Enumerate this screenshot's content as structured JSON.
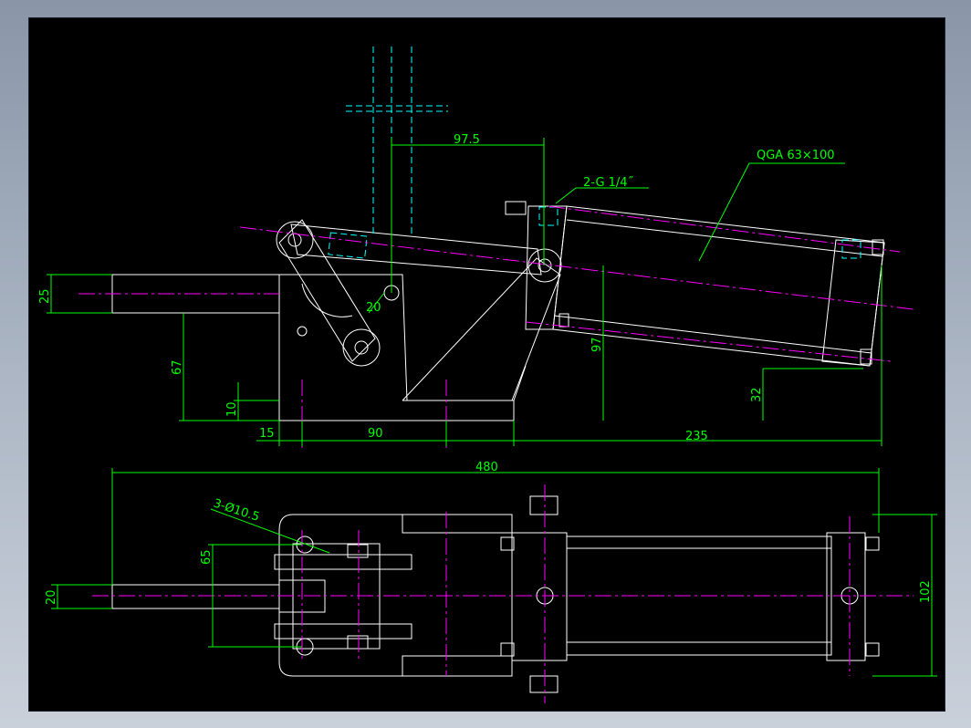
{
  "drawing": {
    "callouts": {
      "cylinder_model": "QGA 63×100",
      "port_thread": "2-G 1/4˝",
      "mount_holes": "3-Ø10.5"
    },
    "dimensions": {
      "d97_5": "97.5",
      "d25": "25",
      "d20_side": "20",
      "d67": "67",
      "d97": "97",
      "d10": "10",
      "d32": "32",
      "d15": "15",
      "d90": "90",
      "d235": "235",
      "d480": "480",
      "d65": "65",
      "d20_plan": "20",
      "d102": "102"
    }
  },
  "colors": {
    "outline": "#ffffff",
    "dimension": "#00ff00",
    "centerline": "#ff00ff",
    "hidden": "#00ffff",
    "background": "#000000"
  }
}
